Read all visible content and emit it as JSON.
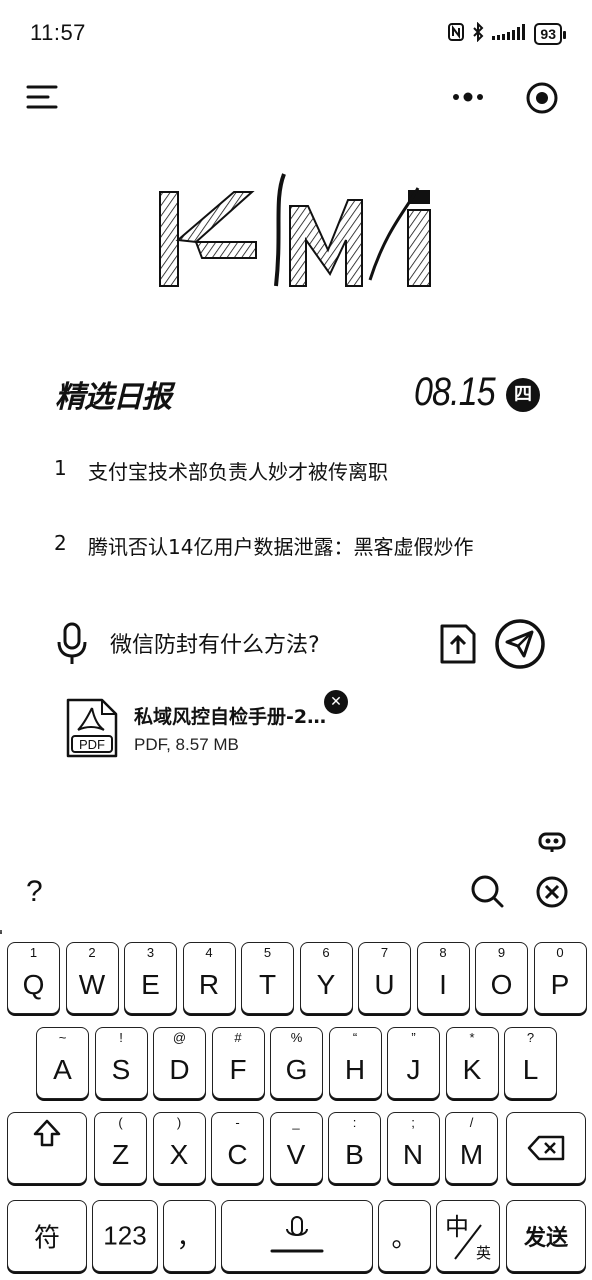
{
  "status_bar": {
    "time": "11:57",
    "battery": "93"
  },
  "logo": {
    "text": "KIMI"
  },
  "daily": {
    "title": "精选日报",
    "date": "08.15",
    "weekday": "四"
  },
  "news": [
    {
      "num": "1",
      "text": "支付宝技术部负责人妙才被传离职"
    },
    {
      "num": "2",
      "text": "腾讯否认14亿用户数据泄露：黑客虚假炒作"
    }
  ],
  "input": {
    "text": "微信防封有什么方法?"
  },
  "attachment": {
    "icon_label": "PDF",
    "name": "私域风控自检手册-2…",
    "meta": "PDF, 8.57 MB"
  },
  "candidates": {
    "first": "?"
  },
  "keyboard": {
    "row1": [
      {
        "main": "Q",
        "sup": "1"
      },
      {
        "main": "W",
        "sup": "2"
      },
      {
        "main": "E",
        "sup": "3"
      },
      {
        "main": "R",
        "sup": "4"
      },
      {
        "main": "T",
        "sup": "5"
      },
      {
        "main": "Y",
        "sup": "6"
      },
      {
        "main": "U",
        "sup": "7"
      },
      {
        "main": "I",
        "sup": "8"
      },
      {
        "main": "O",
        "sup": "9"
      },
      {
        "main": "P",
        "sup": "0"
      }
    ],
    "row2": [
      {
        "main": "A",
        "sup": "~"
      },
      {
        "main": "S",
        "sup": "!"
      },
      {
        "main": "D",
        "sup": "@"
      },
      {
        "main": "F",
        "sup": "#"
      },
      {
        "main": "G",
        "sup": "%"
      },
      {
        "main": "H",
        "sup": "“"
      },
      {
        "main": "J",
        "sup": "”"
      },
      {
        "main": "K",
        "sup": "*"
      },
      {
        "main": "L",
        "sup": "?"
      }
    ],
    "row3": [
      {
        "main": "Z",
        "sup": "("
      },
      {
        "main": "X",
        "sup": ")"
      },
      {
        "main": "C",
        "sup": "-"
      },
      {
        "main": "V",
        "sup": "_"
      },
      {
        "main": "B",
        "sup": ":"
      },
      {
        "main": "N",
        "sup": ";"
      },
      {
        "main": "M",
        "sup": "/"
      }
    ],
    "symbols_label": "符",
    "numbers_label": "123",
    "comma_label": "，",
    "period_label": "。",
    "lang_main": "中",
    "lang_sub": "英",
    "send_label": "发送"
  }
}
